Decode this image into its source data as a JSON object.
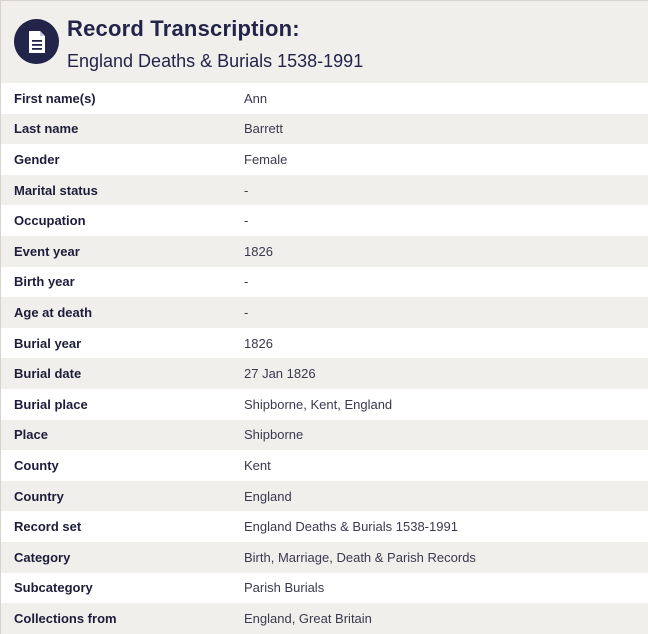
{
  "header": {
    "title": "Record Transcription:",
    "subtitle": "England Deaths & Burials 1538-1991",
    "icon": "document-icon"
  },
  "rows": [
    {
      "label": "First name(s)",
      "value": "Ann"
    },
    {
      "label": "Last name",
      "value": "Barrett"
    },
    {
      "label": "Gender",
      "value": "Female"
    },
    {
      "label": "Marital status",
      "value": "-"
    },
    {
      "label": "Occupation",
      "value": "-"
    },
    {
      "label": "Event year",
      "value": "1826"
    },
    {
      "label": "Birth year",
      "value": "-"
    },
    {
      "label": "Age at death",
      "value": "-"
    },
    {
      "label": "Burial year",
      "value": "1826"
    },
    {
      "label": "Burial date",
      "value": "27 Jan 1826"
    },
    {
      "label": "Burial place",
      "value": "Shipborne, Kent, England"
    },
    {
      "label": "Place",
      "value": "Shipborne"
    },
    {
      "label": "County",
      "value": "Kent"
    },
    {
      "label": "Country",
      "value": "England"
    },
    {
      "label": "Record set",
      "value": "England Deaths & Burials 1538-1991"
    },
    {
      "label": "Category",
      "value": "Birth, Marriage, Death & Parish Records"
    },
    {
      "label": "Subcategory",
      "value": "Parish Burials"
    },
    {
      "label": "Collections from",
      "value": "England, Great Britain"
    }
  ],
  "colors": {
    "navy": "#22244a",
    "row_alt": "#f1efeb",
    "row": "#ffffff"
  }
}
